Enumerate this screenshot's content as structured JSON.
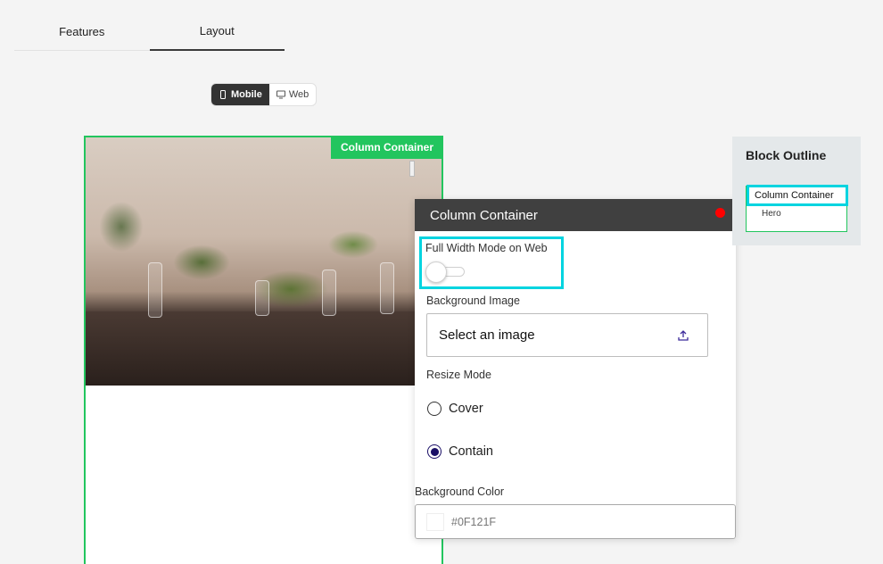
{
  "tabs": [
    {
      "label": "Features"
    },
    {
      "label": "Layout"
    }
  ],
  "device_toggle": {
    "mobile_label": "Mobile",
    "web_label": "Web"
  },
  "canvas": {
    "container_label": "Column Container"
  },
  "panel": {
    "title": "Column Container",
    "full_width_label": "Full Width Mode on Web",
    "background_image_label": "Background Image",
    "select_image_text": "Select an image",
    "resize_mode_label": "Resize Mode",
    "resize_options": [
      {
        "label": "Cover"
      },
      {
        "label": "Contain"
      }
    ],
    "background_color_label": "Background Color",
    "background_color_value": "#0F121F"
  },
  "outline": {
    "title": "Block Outline",
    "root": "Column Container",
    "child": "Hero"
  },
  "colors": {
    "accent_green": "#22c55e",
    "highlight_cyan": "#00d4e0",
    "header_dark": "#404040",
    "close_red": "#ff0000"
  }
}
